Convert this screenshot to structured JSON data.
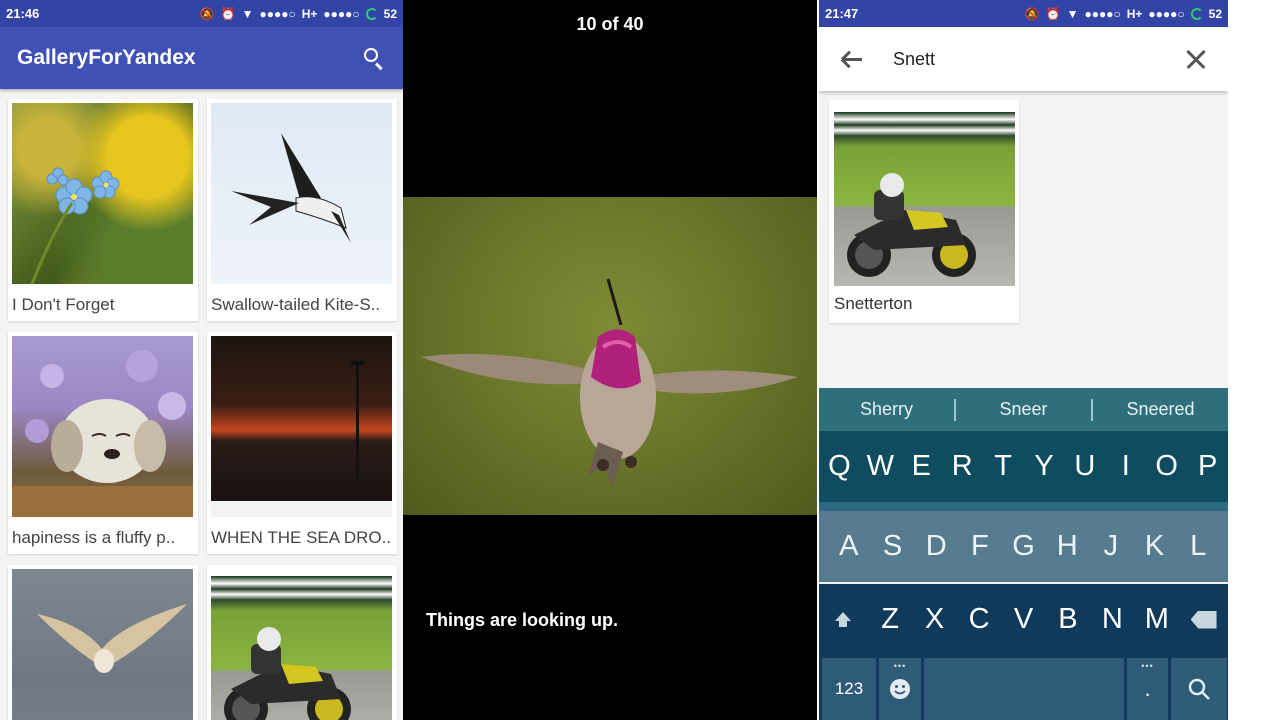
{
  "panel1": {
    "status": {
      "time": "21:46",
      "network": "H+",
      "battery": "52"
    },
    "appbar": {
      "title": "GalleryForYandex",
      "search_icon": "search-icon"
    },
    "gallery": [
      {
        "caption": "I Don't Forget",
        "image": "blue forget-me-not flowers"
      },
      {
        "caption": "Swallow-tailed Kite-S..",
        "image": "swallow-tailed kite in sky"
      },
      {
        "caption": "hapiness is a fluffy p..",
        "image": "fluffy puppy in basket with lilacs"
      },
      {
        "caption": "WHEN THE SEA DRO..",
        "image": "sunset over sea"
      },
      {
        "caption": "",
        "image": "owl flying"
      },
      {
        "caption": "",
        "image": "motorcycle racer"
      }
    ]
  },
  "panel2": {
    "counter": "10 of 40",
    "caption": "Things are looking up.",
    "image": "hummingbird in flight"
  },
  "panel3": {
    "status": {
      "time": "21:47",
      "network": "H+",
      "battery": "52"
    },
    "search": {
      "value": "Snett",
      "back_icon": "arrow-back-icon",
      "close_icon": "close-icon"
    },
    "results": [
      {
        "caption": "Snetterton",
        "image": "motorcycle racer"
      }
    ],
    "keyboard": {
      "suggestions": [
        "Sherry",
        "Sneer",
        "Sneered"
      ],
      "row1": [
        "Q",
        "W",
        "E",
        "R",
        "T",
        "Y",
        "U",
        "I",
        "O",
        "P"
      ],
      "row2": [
        "A",
        "S",
        "D",
        "F",
        "G",
        "H",
        "J",
        "K",
        "L"
      ],
      "row3": [
        "Z",
        "X",
        "C",
        "V",
        "B",
        "N",
        "M"
      ],
      "numbers_key": "123",
      "period_key": ".",
      "dots": "•••"
    }
  },
  "colors": {
    "primary": "#3f51b5",
    "status": "#3245a6",
    "keyboard_bg": "#0f3a5c",
    "suggestion_bg": "#2f6f7c"
  }
}
